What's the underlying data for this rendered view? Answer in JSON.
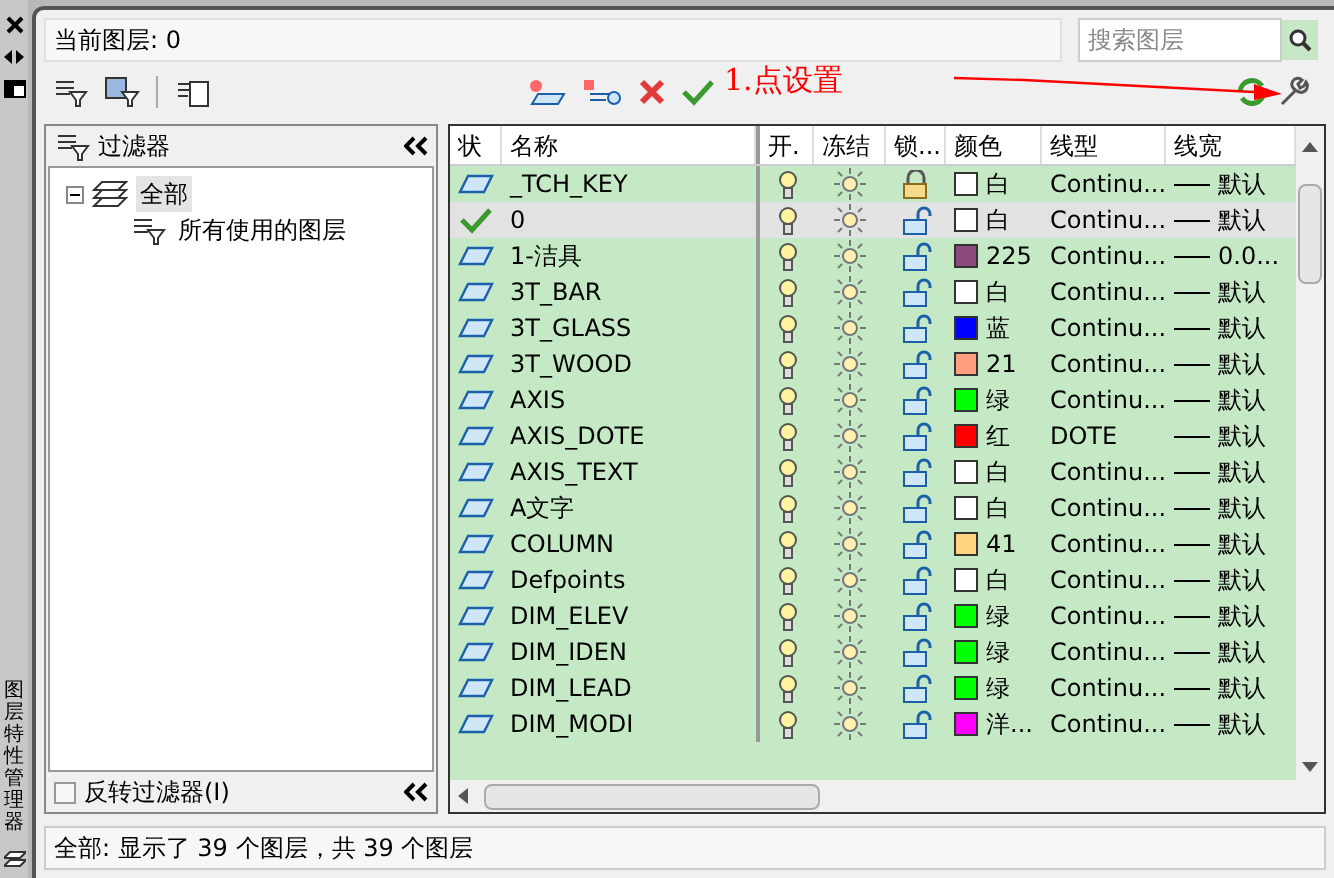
{
  "side_strip": {
    "title": "图层特性管理器"
  },
  "current_layer": {
    "label": "当前图层: 0"
  },
  "search": {
    "placeholder": "搜索图层"
  },
  "annotation": {
    "text": "1.点设置"
  },
  "filter_panel": {
    "title": "过滤器",
    "tree": [
      {
        "label": "全部",
        "selected": true,
        "children": [
          {
            "label": "所有使用的图层",
            "selected": false
          }
        ]
      }
    ],
    "invert": {
      "label": "反转过滤器(I)",
      "checked": false
    }
  },
  "table": {
    "columns": [
      "状",
      "名称",
      "开.",
      "冻结",
      "锁...",
      "颜色",
      "线型",
      "线宽"
    ],
    "rows": [
      {
        "current": false,
        "name": "_TCH_KEY",
        "on": true,
        "frozen": false,
        "locked": true,
        "color": "#ffffff",
        "color_name": "白",
        "linetype": "Continu...",
        "lineweight": "默认",
        "selected": false
      },
      {
        "current": true,
        "name": "0",
        "on": true,
        "frozen": false,
        "locked": false,
        "color": "#ffffff",
        "color_name": "白",
        "linetype": "Continu...",
        "lineweight": "默认",
        "selected": true
      },
      {
        "current": false,
        "name": "1-洁具",
        "on": true,
        "frozen": false,
        "locked": false,
        "color": "#8b4a7c",
        "color_name": "225",
        "linetype": "Continu...",
        "lineweight": "0.0...",
        "selected": false
      },
      {
        "current": false,
        "name": "3T_BAR",
        "on": true,
        "frozen": false,
        "locked": false,
        "color": "#ffffff",
        "color_name": "白",
        "linetype": "Continu...",
        "lineweight": "默认",
        "selected": false
      },
      {
        "current": false,
        "name": "3T_GLASS",
        "on": true,
        "frozen": false,
        "locked": false,
        "color": "#0000ff",
        "color_name": "蓝",
        "linetype": "Continu...",
        "lineweight": "默认",
        "selected": false
      },
      {
        "current": false,
        "name": "3T_WOOD",
        "on": true,
        "frozen": false,
        "locked": false,
        "color": "#ff9f7f",
        "color_name": "21",
        "linetype": "Continu...",
        "lineweight": "默认",
        "selected": false
      },
      {
        "current": false,
        "name": "AXIS",
        "on": true,
        "frozen": false,
        "locked": false,
        "color": "#00ff00",
        "color_name": "绿",
        "linetype": "Continu...",
        "lineweight": "默认",
        "selected": false
      },
      {
        "current": false,
        "name": "AXIS_DOTE",
        "on": true,
        "frozen": false,
        "locked": false,
        "color": "#ff0000",
        "color_name": "红",
        "linetype": "DOTE",
        "lineweight": "默认",
        "selected": false
      },
      {
        "current": false,
        "name": "AXIS_TEXT",
        "on": true,
        "frozen": false,
        "locked": false,
        "color": "#ffffff",
        "color_name": "白",
        "linetype": "Continu...",
        "lineweight": "默认",
        "selected": false
      },
      {
        "current": false,
        "name": "A文字",
        "on": true,
        "frozen": false,
        "locked": false,
        "color": "#ffffff",
        "color_name": "白",
        "linetype": "Continu...",
        "lineweight": "默认",
        "selected": false
      },
      {
        "current": false,
        "name": "COLUMN",
        "on": true,
        "frozen": false,
        "locked": false,
        "color": "#ffd37f",
        "color_name": "41",
        "linetype": "Continu...",
        "lineweight": "默认",
        "selected": false
      },
      {
        "current": false,
        "name": "Defpoints",
        "on": true,
        "frozen": false,
        "locked": false,
        "color": "#ffffff",
        "color_name": "白",
        "linetype": "Continu...",
        "lineweight": "默认",
        "selected": false
      },
      {
        "current": false,
        "name": "DIM_ELEV",
        "on": true,
        "frozen": false,
        "locked": false,
        "color": "#00ff00",
        "color_name": "绿",
        "linetype": "Continu...",
        "lineweight": "默认",
        "selected": false
      },
      {
        "current": false,
        "name": "DIM_IDEN",
        "on": true,
        "frozen": false,
        "locked": false,
        "color": "#00ff00",
        "color_name": "绿",
        "linetype": "Continu...",
        "lineweight": "默认",
        "selected": false
      },
      {
        "current": false,
        "name": "DIM_LEAD",
        "on": true,
        "frozen": false,
        "locked": false,
        "color": "#00ff00",
        "color_name": "绿",
        "linetype": "Continu...",
        "lineweight": "默认",
        "selected": false
      },
      {
        "current": false,
        "name": "DIM_MODI",
        "on": true,
        "frozen": false,
        "locked": false,
        "color": "#ff00ff",
        "color_name": "洋...",
        "linetype": "Continu...",
        "lineweight": "默认",
        "selected": false
      }
    ]
  },
  "status_bar": {
    "text": "全部: 显示了 39 个图层，共 39 个图层"
  }
}
